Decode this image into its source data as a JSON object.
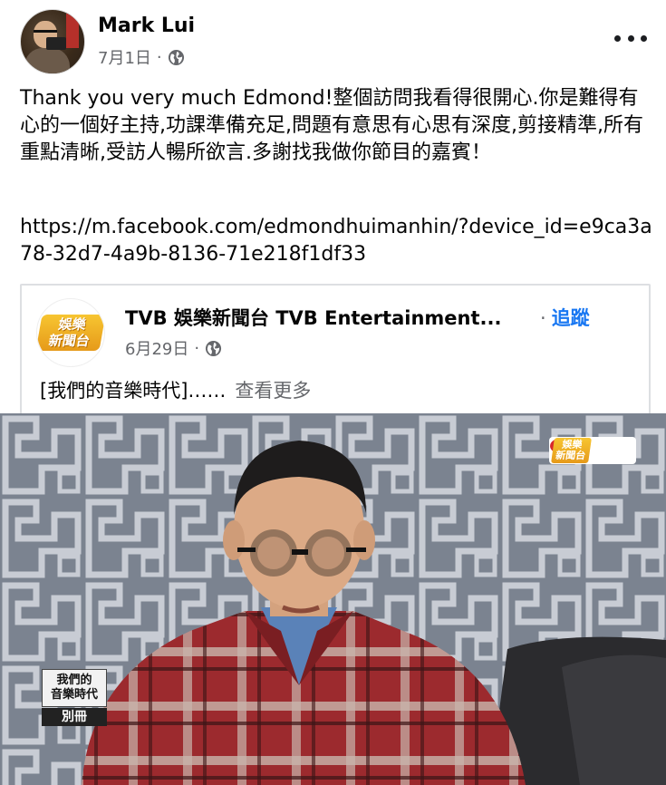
{
  "post": {
    "author": "Mark Lui",
    "date": "7月1日",
    "separator": "·",
    "text": "Thank you very much Edmond!整個訪問我看得很開心.你是難得有心的一個好主持,功課準備充足,問題有意思有心思有深度,剪接精準,所有重點清晰,受訪人暢所欲言.多謝找我做你節目的嘉賓！",
    "link": "https://m.facebook.com/edmondhuimanhin/?device_id=e9ca3a78-32d7-4a9b-8136-71e218f1df33"
  },
  "shared": {
    "page_name": "TVB 娛樂新聞台 TVB Entertainment...",
    "follow_label": "追蹤",
    "separator": "·",
    "date": "6月29日",
    "text": "[我們的音樂時代]……",
    "see_more": "查看更多",
    "logo_text_line1": "娛樂",
    "logo_text_line2": "新聞台"
  },
  "video": {
    "badge_text_line1": "娛樂",
    "badge_text_line2": "新聞台",
    "caption_line1": "我們的",
    "caption_line2": "音樂時代",
    "caption_line3": "別冊"
  },
  "icons": {
    "privacy": "globe-icon",
    "menu": "more-dots-icon"
  },
  "colors": {
    "link_blue": "#1877f2",
    "meta_gray": "#65676b",
    "tvb_gold": "#f7c531"
  }
}
